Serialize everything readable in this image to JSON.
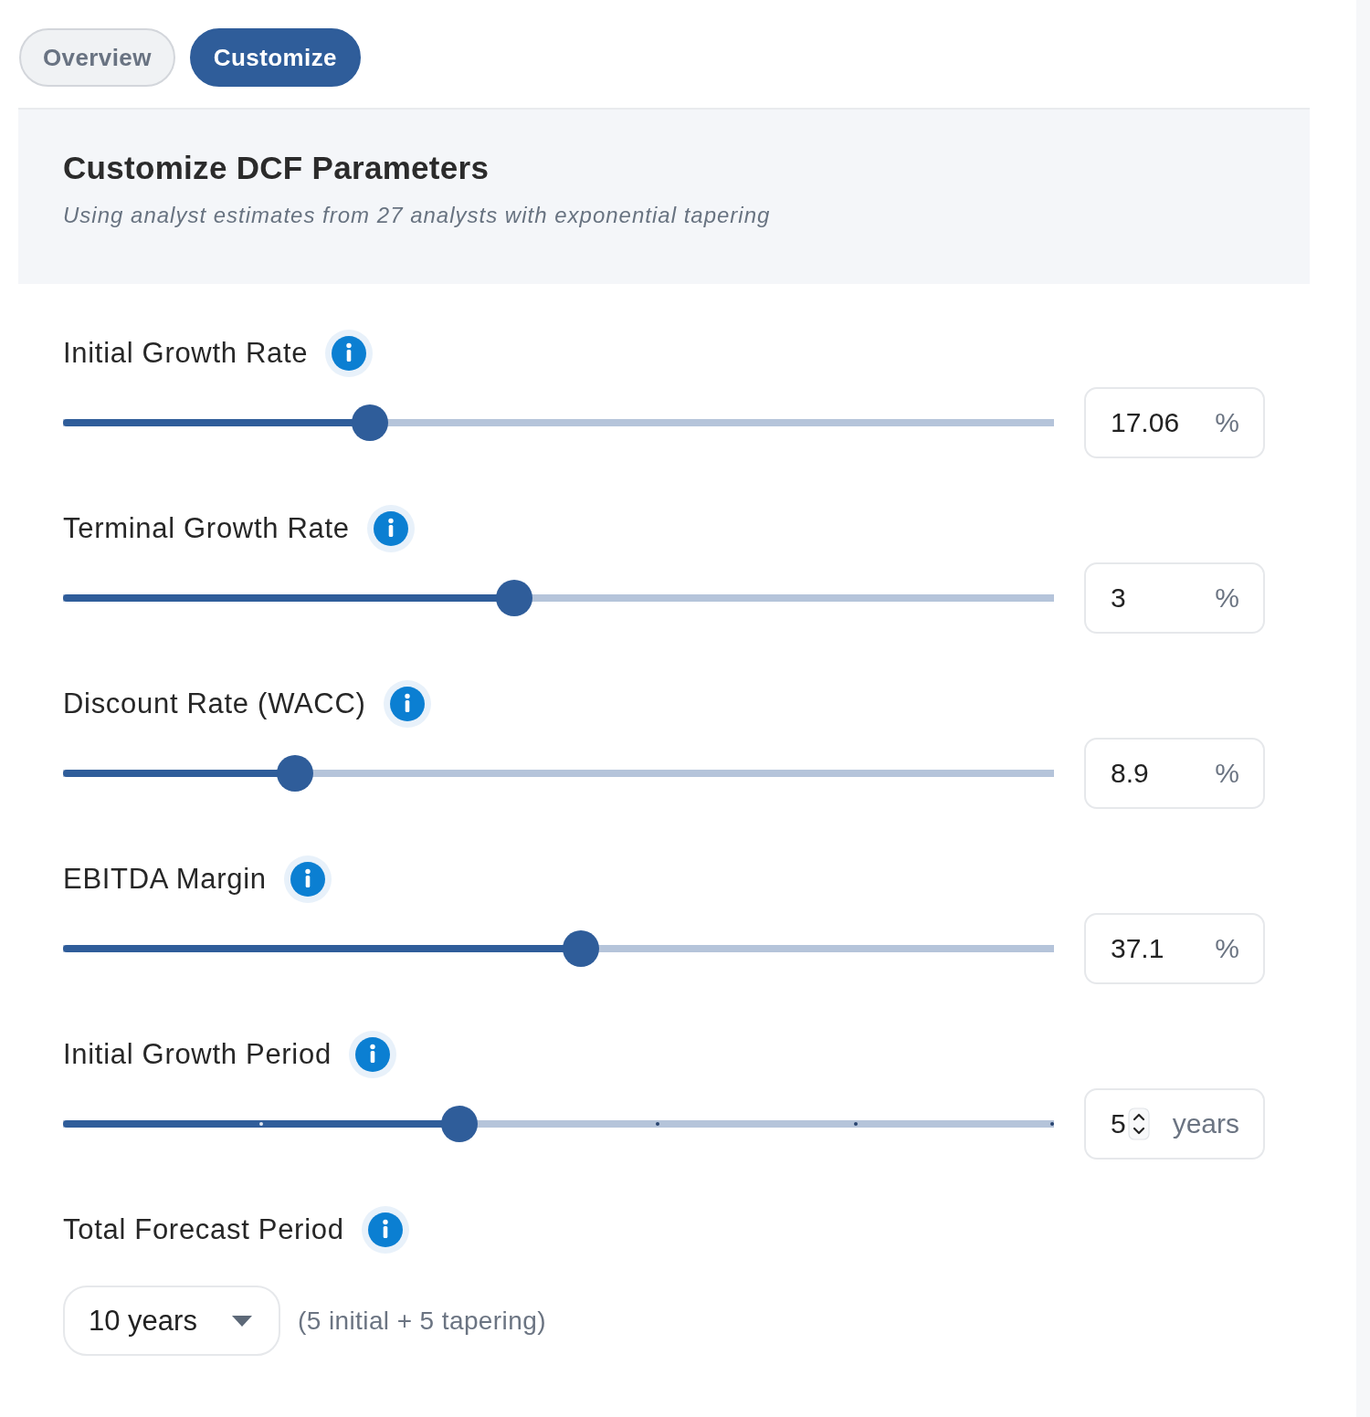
{
  "tabs": [
    {
      "label": "Overview",
      "selected": false
    },
    {
      "label": "Customize",
      "selected": true
    }
  ],
  "header": {
    "title": "Customize DCF Parameters",
    "subtitle": "Using analyst estimates from 27 analysts with exponential tapering"
  },
  "parameters": [
    {
      "kind": "slider",
      "label": "Initial Growth Rate",
      "level": 0.31,
      "value": "17.06",
      "unit": "%"
    },
    {
      "kind": "slider",
      "label": "Terminal Growth Rate",
      "level": 0.455,
      "value": "3",
      "unit": "%"
    },
    {
      "kind": "slider",
      "label": "Discount Rate (WACC)",
      "level": 0.234,
      "value": "8.9",
      "unit": "%"
    },
    {
      "kind": "slider",
      "label": "EBITDA Margin",
      "level": 0.523,
      "value": "37.1",
      "unit": "%"
    },
    {
      "kind": "stepper",
      "label": "Initial Growth Period",
      "level": 0.4,
      "value": "5",
      "unit": "years"
    },
    {
      "kind": "select",
      "label": "Total Forecast Period",
      "value": "10 years",
      "note": "(5 initial + 5 tapering)"
    }
  ]
}
